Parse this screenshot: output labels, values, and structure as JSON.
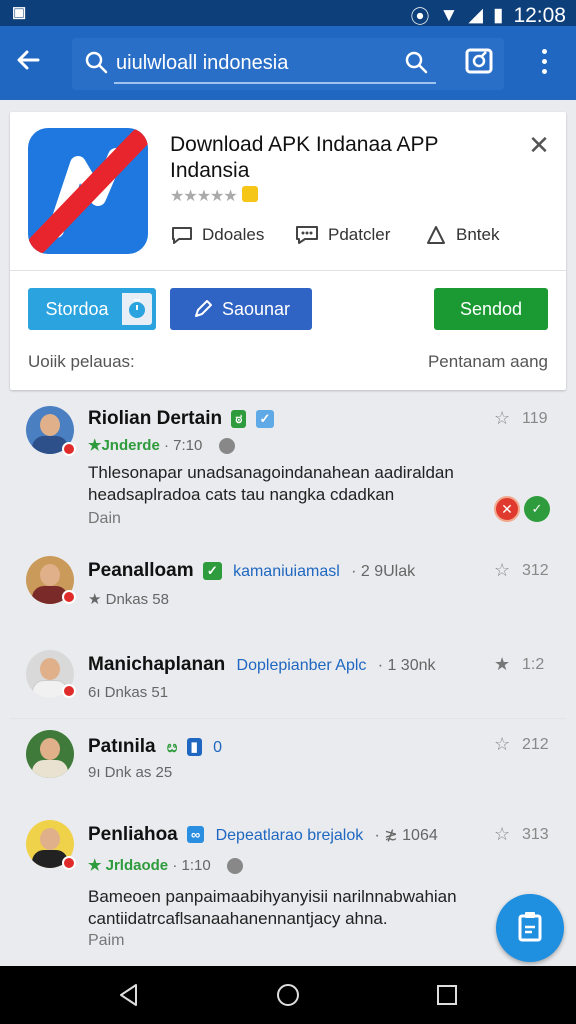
{
  "status_bar": {
    "left_icon": "notification-icon",
    "time": "12:08"
  },
  "app_bar": {
    "search_value": "uiulwloall indonesia"
  },
  "app": {
    "title": "Download APK Indanaa APP Indansia",
    "rating_stars": "★★★★★",
    "actions": [
      {
        "label": "Ddoales",
        "icon": "chat-bubble-icon"
      },
      {
        "label": "Pdatcler",
        "icon": "comment-icon"
      },
      {
        "label": "Bntek",
        "icon": "share-icon"
      }
    ],
    "buttons": {
      "primary": "Stordoa",
      "secondary": "Saounar",
      "install": "Sendod"
    },
    "footer_left": "Uoiik pelauas:",
    "footer_right": "Pentanam aang"
  },
  "reviews": [
    {
      "name": "Riolian Dertain",
      "badge": "ಠ",
      "sub_handle": "★Jnderde",
      "sub_time": "· 7:10",
      "count": "119",
      "body": "Thlesonapar unadsanagoindanahean aadiraldan headsaplradoa cats tau nangka cdadkan",
      "foot": "Dain"
    },
    {
      "name": "Peanalloam",
      "tag": "kamaniuiamasl",
      "tag_meta": "· 2 9Ulak",
      "sub": "★ Dnkas 58",
      "count": "312"
    },
    {
      "name": "Manichaplanan",
      "tag": "Doplepianber Aplc",
      "tag_meta": "· 1 30nk",
      "sub": "6ı Dnkas 51",
      "count": "1:2"
    },
    {
      "name": "Patınila",
      "tag": "0",
      "sub": "9ı Dnk as 25",
      "count": "212"
    },
    {
      "name": "Penliahoa",
      "tag": "Depeatlarao brejalok",
      "tag_meta": "· ≵ 1064",
      "sub_handle": "★ Jrldaode",
      "sub_time": "· 1:10",
      "count": "313",
      "body": "Bameoen panpaimaabihyanyisii narilnnabwahian cantiidatrcaflsanaahanennantjacy ahna.",
      "foot": "Paim"
    }
  ],
  "colors": {
    "app_bar": "#1f67c0",
    "status_bar": "#0d3f7a",
    "accent_green": "#1b9a34",
    "fab": "#1f8fe0"
  }
}
